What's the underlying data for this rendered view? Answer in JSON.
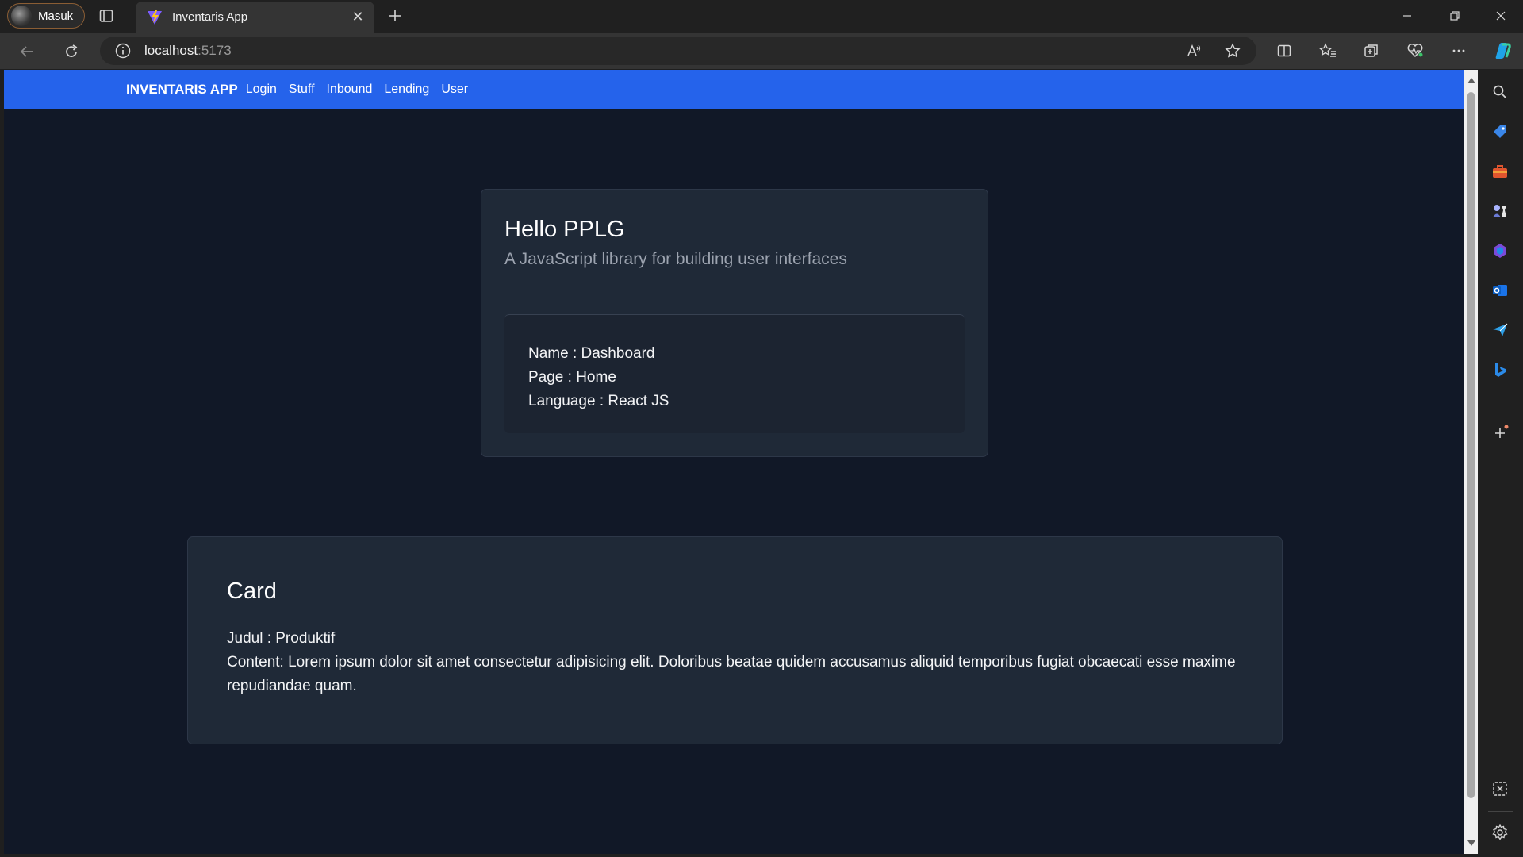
{
  "browser": {
    "profile_label": "Masuk",
    "tab_title": "Inventaris App",
    "url_host": "localhost",
    "url_port": ":5173"
  },
  "nav": {
    "brand": "INVENTARIS APP",
    "links": [
      "Login",
      "Stuff",
      "Inbound",
      "Lending",
      "User"
    ]
  },
  "hero": {
    "title": "Hello PPLG",
    "subtitle": "A JavaScript library for building user interfaces",
    "details": [
      "Name : Dashboard",
      "Page : Home",
      "Language : React JS"
    ]
  },
  "card": {
    "title": "Card",
    "judul": "Judul : Produktif",
    "content": "Content: Lorem ipsum dolor sit amet consectetur adipisicing elit. Doloribus beataе quidem accusamus aliquid temporibus fugiat obcaecati esse maxime repudiandae quam."
  },
  "colors": {
    "nav_bg": "#2563eb",
    "page_bg": "#111827",
    "card_bg": "#1f2937"
  }
}
